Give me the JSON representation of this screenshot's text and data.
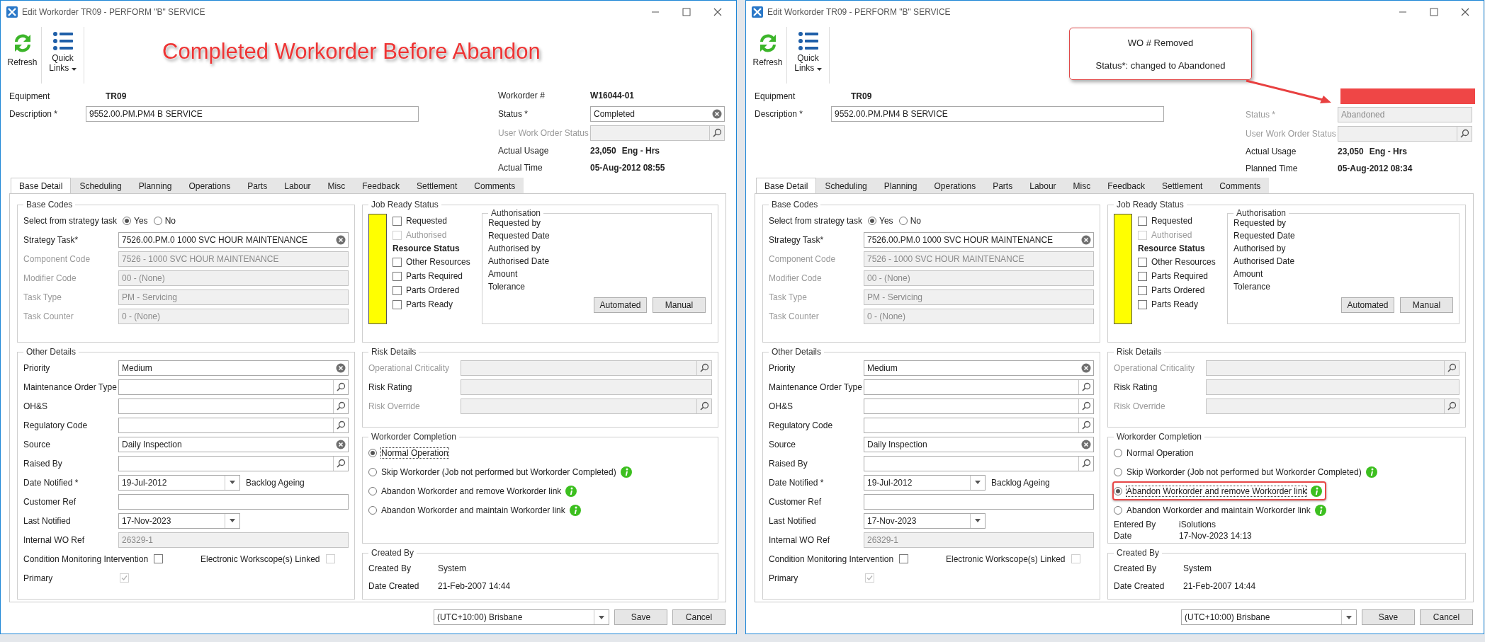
{
  "windows": [
    {
      "title": "Edit Workorder TR09 - PERFORM \"B\" SERVICE",
      "toolbar": [
        {
          "kind": "refresh",
          "label": "Refresh",
          "menu": false
        },
        {
          "kind": "links",
          "label": "Quick Links",
          "menu": true
        }
      ],
      "annotation": {
        "kind": "banner",
        "lines": [
          "Completed Workorder Before Abandon"
        ]
      },
      "equipment": {
        "label": "Equipment",
        "value": "TR09"
      },
      "description": {
        "label": "Description *",
        "value": "9552.00.PM.PM4 B SERVICE"
      },
      "summary": [
        {
          "kind": "text",
          "label": "Workorder #",
          "value": "W16044-01"
        },
        {
          "kind": "clearable",
          "label": "Status *",
          "value": "Completed",
          "disabled": false,
          "read_only": false
        },
        {
          "kind": "lookup",
          "label": "User Work Order Status",
          "disabled": true,
          "read_only": true
        },
        {
          "kind": "text",
          "label": "Actual Usage",
          "value": "23,050",
          "unit": "Eng - Hrs"
        },
        {
          "kind": "text",
          "label": "Actual Time",
          "value": "05-Aug-2012 08:55"
        }
      ],
      "tabs": [
        {
          "label": "Base Detail",
          "selected": true
        },
        {
          "label": "Scheduling",
          "selected": false
        },
        {
          "label": "Planning",
          "selected": false
        },
        {
          "label": "Operations",
          "selected": false
        },
        {
          "label": "Parts",
          "selected": false
        },
        {
          "label": "Labour",
          "selected": false
        },
        {
          "label": "Misc",
          "selected": false
        },
        {
          "label": "Feedback",
          "selected": false
        },
        {
          "label": "Settlement",
          "selected": false
        },
        {
          "label": "Comments",
          "selected": false
        }
      ],
      "base_codes": {
        "title": "Base Codes",
        "choice": {
          "label": "Select from strategy task",
          "options": [
            {
              "label": "Yes",
              "selected": true
            },
            {
              "label": "No",
              "selected": false
            }
          ]
        },
        "fields": [
          {
            "kind": "clearable",
            "label": "Strategy Task*",
            "value": "7526.00.PM.0 1000 SVC HOUR MAINTENANCE",
            "disabled": false,
            "read_only": false
          },
          {
            "kind": "plain",
            "label": "Component Code",
            "value": "7526 - 1000 SVC HOUR MAINTENANCE",
            "disabled": true,
            "read_only": true
          },
          {
            "kind": "plain",
            "label": "Modifier Code",
            "value": "00 - (None)",
            "disabled": true,
            "read_only": true
          },
          {
            "kind": "plain",
            "label": "Task Type",
            "value": "PM - Servicing",
            "disabled": true,
            "read_only": true
          },
          {
            "kind": "plain",
            "label": "Task Counter",
            "value": "0 - (None)",
            "disabled": true,
            "read_only": true
          }
        ]
      },
      "job_ready": {
        "title": "Job Ready Status",
        "checks": [
          {
            "kind": "check",
            "label": "Requested",
            "checked": false,
            "disabled": false
          },
          {
            "kind": "check",
            "label": "Authorised",
            "checked": false,
            "disabled": true
          },
          {
            "kind": "heading",
            "label": "Resource Status"
          },
          {
            "kind": "check",
            "label": "Other Resources",
            "checked": false,
            "disabled": false
          },
          {
            "kind": "check",
            "label": "Parts Required",
            "checked": false,
            "disabled": false
          },
          {
            "kind": "check",
            "label": "Parts Ordered",
            "checked": false,
            "disabled": false
          },
          {
            "kind": "check",
            "label": "Parts Ready",
            "checked": false,
            "disabled": false
          }
        ],
        "authorisation": {
          "title": "Authorisation",
          "labels": [
            "Requested by",
            "Requested Date",
            "Authorised by",
            "Authorised Date",
            "Amount",
            "Tolerance"
          ],
          "buttons": [
            "Automated",
            "Manual"
          ]
        }
      },
      "other_details": {
        "title": "Other Details",
        "fields": [
          {
            "kind": "clearable",
            "label": "Priority",
            "value": "Medium",
            "disabled": false,
            "read_only": false
          },
          {
            "kind": "lookup",
            "label": "Maintenance Order Type",
            "disabled": false,
            "read_only": false
          },
          {
            "kind": "lookup",
            "label": "OH&S",
            "disabled": false,
            "read_only": false
          },
          {
            "kind": "lookup",
            "label": "Regulatory Code",
            "disabled": false,
            "read_only": false
          },
          {
            "kind": "clearable",
            "label": "Source",
            "value": "Daily Inspection",
            "disabled": false,
            "read_only": false
          },
          {
            "kind": "lookup",
            "label": "Raised By",
            "disabled": false,
            "read_only": false
          },
          {
            "kind": "date",
            "label": "Date Notified *",
            "value": "19-Jul-2012",
            "note": "Backlog Ageing",
            "disabled": false,
            "read_only": false
          },
          {
            "kind": "plain",
            "label": "Customer Ref",
            "disabled": false,
            "read_only": false
          },
          {
            "kind": "date",
            "label": "Last Notified",
            "value": "17-Nov-2023",
            "disabled": false,
            "read_only": false
          },
          {
            "kind": "plain",
            "label": "Internal WO Ref",
            "value": "26329-1",
            "disabled": false,
            "read_only": true
          }
        ],
        "flags": [
          {
            "label": "Condition Monitoring Intervention",
            "checked": false,
            "disabled": false
          },
          {
            "label": "Electronic Workscope(s) Linked",
            "checked": false,
            "disabled": true
          },
          {
            "label": "Primary",
            "checked": true,
            "disabled": true
          }
        ]
      },
      "risk": {
        "title": "Risk Details",
        "fields": [
          {
            "kind": "lookup",
            "label": "Operational Criticality",
            "disabled": true,
            "read_only": true
          },
          {
            "kind": "plain",
            "label": "Risk Rating",
            "disabled": false,
            "read_only": true
          },
          {
            "kind": "lookup",
            "label": "Risk Override",
            "disabled": true,
            "read_only": true
          }
        ]
      },
      "completion": {
        "title": "Workorder Completion",
        "options": [
          {
            "label": "Normal Operation",
            "selected": true,
            "info": false,
            "highlighted": false
          },
          {
            "label": "Skip Workorder (Job not performed but Workorder Completed)",
            "selected": false,
            "info": true,
            "highlighted": false
          },
          {
            "label": "Abandon Workorder and remove Workorder link",
            "selected": false,
            "info": true,
            "highlighted": false
          },
          {
            "label": "Abandon Workorder and maintain Workorder link",
            "selected": false,
            "info": true,
            "highlighted": false
          }
        ]
      },
      "created": {
        "title": "Created By",
        "rows": [
          {
            "label": "Created By",
            "value": "System"
          },
          {
            "label": "Date Created",
            "value": "21-Feb-2007 14:44"
          }
        ]
      },
      "footer": {
        "timezone": "(UTC+10:00) Brisbane",
        "buttons": [
          "Save",
          "Cancel"
        ]
      }
    },
    {
      "title": "Edit Workorder TR09 - PERFORM \"B\" SERVICE",
      "toolbar": [
        {
          "kind": "refresh",
          "label": "Refresh",
          "menu": false
        },
        {
          "kind": "links",
          "label": "Quick Links",
          "menu": true
        }
      ],
      "annotation": {
        "kind": "callout",
        "lines": [
          "WO # Removed",
          "Status*: changed to Abandoned"
        ]
      },
      "equipment": {
        "label": "Equipment",
        "value": "TR09"
      },
      "description": {
        "label": "Description *",
        "value": "9552.00.PM.PM4 B SERVICE"
      },
      "summary": [
        {
          "kind": "redacted"
        },
        {
          "kind": "plain",
          "label": "Status *",
          "value": "Abandoned",
          "disabled": true,
          "read_only": true
        },
        {
          "kind": "lookup",
          "label": "User Work Order Status",
          "disabled": true,
          "read_only": true
        },
        {
          "kind": "text",
          "label": "Actual Usage",
          "value": "23,050",
          "unit": "Eng - Hrs"
        },
        {
          "kind": "text",
          "label": "Planned Time",
          "value": "05-Aug-2012 08:34"
        }
      ],
      "tabs": [
        {
          "label": "Base Detail",
          "selected": true
        },
        {
          "label": "Scheduling",
          "selected": false
        },
        {
          "label": "Planning",
          "selected": false
        },
        {
          "label": "Operations",
          "selected": false
        },
        {
          "label": "Parts",
          "selected": false
        },
        {
          "label": "Labour",
          "selected": false
        },
        {
          "label": "Misc",
          "selected": false
        },
        {
          "label": "Feedback",
          "selected": false
        },
        {
          "label": "Settlement",
          "selected": false
        },
        {
          "label": "Comments",
          "selected": false
        }
      ],
      "base_codes": {
        "title": "Base Codes",
        "choice": {
          "label": "Select from strategy task",
          "options": [
            {
              "label": "Yes",
              "selected": true
            },
            {
              "label": "No",
              "selected": false
            }
          ]
        },
        "fields": [
          {
            "kind": "clearable",
            "label": "Strategy Task*",
            "value": "7526.00.PM.0 1000 SVC HOUR MAINTENANCE",
            "disabled": false,
            "read_only": false
          },
          {
            "kind": "plain",
            "label": "Component Code",
            "value": "7526 - 1000 SVC HOUR MAINTENANCE",
            "disabled": true,
            "read_only": true
          },
          {
            "kind": "plain",
            "label": "Modifier Code",
            "value": "00 - (None)",
            "disabled": true,
            "read_only": true
          },
          {
            "kind": "plain",
            "label": "Task Type",
            "value": "PM - Servicing",
            "disabled": true,
            "read_only": true
          },
          {
            "kind": "plain",
            "label": "Task Counter",
            "value": "0 - (None)",
            "disabled": true,
            "read_only": true
          }
        ]
      },
      "job_ready": {
        "title": "Job Ready Status",
        "checks": [
          {
            "kind": "check",
            "label": "Requested",
            "checked": false,
            "disabled": false
          },
          {
            "kind": "check",
            "label": "Authorised",
            "checked": false,
            "disabled": true
          },
          {
            "kind": "heading",
            "label": "Resource Status"
          },
          {
            "kind": "check",
            "label": "Other Resources",
            "checked": false,
            "disabled": false
          },
          {
            "kind": "check",
            "label": "Parts Required",
            "checked": false,
            "disabled": false
          },
          {
            "kind": "check",
            "label": "Parts Ordered",
            "checked": false,
            "disabled": false
          },
          {
            "kind": "check",
            "label": "Parts Ready",
            "checked": false,
            "disabled": false
          }
        ],
        "authorisation": {
          "title": "Authorisation",
          "labels": [
            "Requested by",
            "Requested Date",
            "Authorised by",
            "Authorised Date",
            "Amount",
            "Tolerance"
          ],
          "buttons": [
            "Automated",
            "Manual"
          ]
        }
      },
      "other_details": {
        "title": "Other Details",
        "fields": [
          {
            "kind": "clearable",
            "label": "Priority",
            "value": "Medium",
            "disabled": false,
            "read_only": false
          },
          {
            "kind": "lookup",
            "label": "Maintenance Order Type",
            "disabled": false,
            "read_only": false
          },
          {
            "kind": "lookup",
            "label": "OH&S",
            "disabled": false,
            "read_only": false
          },
          {
            "kind": "lookup",
            "label": "Regulatory Code",
            "disabled": false,
            "read_only": false
          },
          {
            "kind": "clearable",
            "label": "Source",
            "value": "Daily Inspection",
            "disabled": false,
            "read_only": false
          },
          {
            "kind": "lookup",
            "label": "Raised By",
            "disabled": false,
            "read_only": false
          },
          {
            "kind": "date",
            "label": "Date Notified *",
            "value": "19-Jul-2012",
            "note": "Backlog Ageing",
            "disabled": false,
            "read_only": false
          },
          {
            "kind": "plain",
            "label": "Customer Ref",
            "disabled": false,
            "read_only": false
          },
          {
            "kind": "date",
            "label": "Last Notified",
            "value": "17-Nov-2023",
            "disabled": false,
            "read_only": false
          },
          {
            "kind": "plain",
            "label": "Internal WO Ref",
            "value": "26329-1",
            "disabled": false,
            "read_only": true
          }
        ],
        "flags": [
          {
            "label": "Condition Monitoring Intervention",
            "checked": false,
            "disabled": false
          },
          {
            "label": "Electronic Workscope(s) Linked",
            "checked": false,
            "disabled": true
          },
          {
            "label": "Primary",
            "checked": true,
            "disabled": true
          }
        ]
      },
      "risk": {
        "title": "Risk Details",
        "fields": [
          {
            "kind": "lookup",
            "label": "Operational Criticality",
            "disabled": true,
            "read_only": true
          },
          {
            "kind": "plain",
            "label": "Risk Rating",
            "disabled": false,
            "read_only": true
          },
          {
            "kind": "lookup",
            "label": "Risk Override",
            "disabled": true,
            "read_only": true
          }
        ]
      },
      "completion": {
        "title": "Workorder Completion",
        "options": [
          {
            "label": "Normal Operation",
            "selected": false,
            "info": false,
            "highlighted": false
          },
          {
            "label": "Skip Workorder (Job not performed but Workorder Completed)",
            "selected": false,
            "info": true,
            "highlighted": false
          },
          {
            "label": "Abandon Workorder and remove Workorder link",
            "selected": true,
            "info": true,
            "highlighted": true
          },
          {
            "label": "Abandon Workorder and maintain Workorder link",
            "selected": false,
            "info": true,
            "highlighted": false
          }
        ],
        "entries": [
          {
            "label": "Entered By",
            "value": "iSolutions"
          },
          {
            "label": "Date",
            "value": "17-Nov-2023 14:13"
          }
        ]
      },
      "created": {
        "title": "Created By",
        "rows": [
          {
            "label": "Created By",
            "value": "System"
          },
          {
            "label": "Date Created",
            "value": "21-Feb-2007 14:44"
          }
        ]
      },
      "footer": {
        "timezone": "(UTC+10:00) Brisbane",
        "buttons": [
          "Save",
          "Cancel"
        ]
      }
    }
  ]
}
